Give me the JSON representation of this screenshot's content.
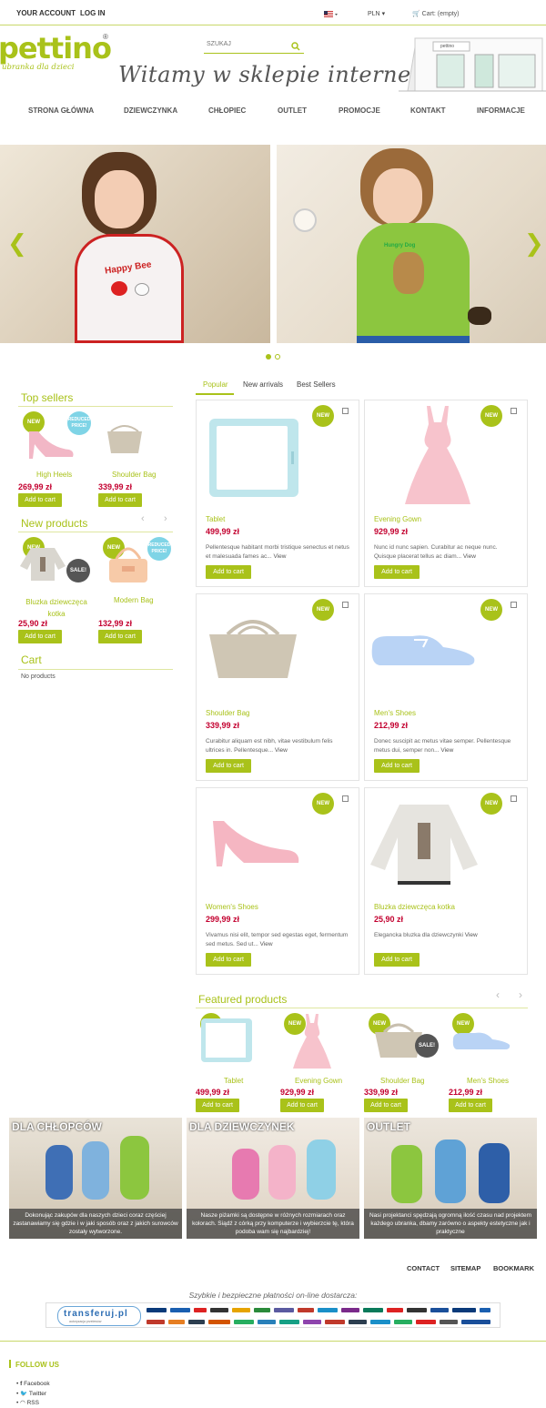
{
  "header": {
    "account": "YOUR ACCOUNT",
    "login": "LOG IN",
    "currency": "PLN",
    "cart": "Cart: (empty)"
  },
  "logo": {
    "name": "pettino",
    "reg": "®",
    "tagline": "ubranka dla dzieci"
  },
  "search": {
    "placeholder": "SZUKAJ"
  },
  "welcome": "Witamy w sklepie internetowym",
  "storefront_sign": "pettino",
  "menu": [
    "STRONA GŁÓWNA",
    "DZIEWCZYNKA",
    "CHŁOPIEC",
    "OUTLET",
    "PROMOCJE",
    "KONTAKT",
    "INFORMACJE"
  ],
  "slider": {
    "left_shirt": "Happy Bee",
    "right_shirt": "Hungry Dog"
  },
  "tabs": [
    "Popular",
    "New arrivals",
    "Best Sellers"
  ],
  "badges": {
    "new": "NEW",
    "reduced_1": "REDUCED",
    "reduced_2": "PRICE!",
    "sale": "SALE!"
  },
  "sidebar": {
    "top_sellers": {
      "title": "Top sellers",
      "items": [
        {
          "name": "High Heels",
          "price": "269,99 zł",
          "btn": "Add to cart"
        },
        {
          "name": "Shoulder Bag",
          "price": "339,99 zł",
          "btn": "Add to cart"
        }
      ]
    },
    "new_products": {
      "title": "New products",
      "items": [
        {
          "name": "Bluzka dziewczęca kotka",
          "price": "25,90 zł",
          "btn": "Add to cart"
        },
        {
          "name": "Modern Bag",
          "price": "132,99 zł",
          "btn": "Add to cart"
        }
      ]
    },
    "cart": {
      "title": "Cart",
      "empty": "No products"
    }
  },
  "products": [
    {
      "name": "Tablet",
      "price": "499,99 zł",
      "desc": "Pellentesque habitant morbi tristique senectus et netus et malesuada fames ac...",
      "view": "View",
      "btn": "Add to cart"
    },
    {
      "name": "Evening Gown",
      "price": "929,99 zł",
      "desc": "Nunc id nunc sapien. Curabitur ac neque nunc. Quisque placerat tellus ac diam...",
      "view": "View",
      "btn": "Add to cart"
    },
    {
      "name": "Shoulder Bag",
      "price": "339,99 zł",
      "desc": "Curabitur aliquam est nibh, vitae vestibulum felis ultrices in. Pellentesque...",
      "view": "View",
      "btn": "Add to cart"
    },
    {
      "name": "Men's Shoes",
      "price": "212,99 zł",
      "desc": "Donec suscipit ac metus vitae semper. Pellentesque metus dui, semper non...",
      "view": "View",
      "btn": "Add to cart"
    },
    {
      "name": "Women's Shoes",
      "price": "299,99 zł",
      "desc": "Vivamus nisi elit, tempor sed egestas eget, fermentum sed metus. Sed ut...",
      "view": "View",
      "btn": "Add to cart"
    },
    {
      "name": "Bluzka dziewczęca kotka",
      "price": "25,90 zł",
      "desc": "Elegancka bluzka dla dziewczynki",
      "view": "View",
      "btn": "Add to cart"
    }
  ],
  "featured": {
    "title": "Featured products",
    "items": [
      {
        "name": "Tablet",
        "price": "499,99 zł",
        "btn": "Add to cart"
      },
      {
        "name": "Evening Gown",
        "price": "929,99 zł",
        "btn": "Add to cart"
      },
      {
        "name": "Shoulder Bag",
        "price": "339,99 zł",
        "btn": "Add to cart"
      },
      {
        "name": "Men's Shoes",
        "price": "212,99 zł",
        "btn": "Add to cart"
      }
    ]
  },
  "categories": [
    {
      "title": "DLA CHŁOPCÓW",
      "text": "Dokonując zakupów dla naszych dzieci coraz częściej zastanawiamy się gdzie i w jaki sposób oraz z jakich surowców zostały wytworzone."
    },
    {
      "title": "DLA DZIEWCZYNEK",
      "text": "Nasze piżamki są dostępne w różnych rozmiarach oraz kolorach. Siądź z córką przy komputerze i wybierzcie tę, która podoba wam się najbardziej!"
    },
    {
      "title": "OUTLET",
      "text": "Nasi projektanci spędzają ogromną ilość czasu nad projektem każdego ubranka, dbamy zarówno o aspekty estetyczne jak i praktyczne"
    }
  ],
  "footer_links": [
    "CONTACT",
    "SITEMAP",
    "BOOKMARK"
  ],
  "payments": {
    "caption": "Szybkie i bezpieczne płatności on-line dostarcza:",
    "brand": "transferuj.pl",
    "brand_sub": "autoryzacja przelewów"
  },
  "follow": {
    "title": "FOLLOW US",
    "items": [
      "Facebook",
      "Twitter",
      "RSS"
    ]
  },
  "colors": {
    "accent": "#a9c21a",
    "price": "#c3002f",
    "badge_reduced": "#7fd4e6"
  }
}
